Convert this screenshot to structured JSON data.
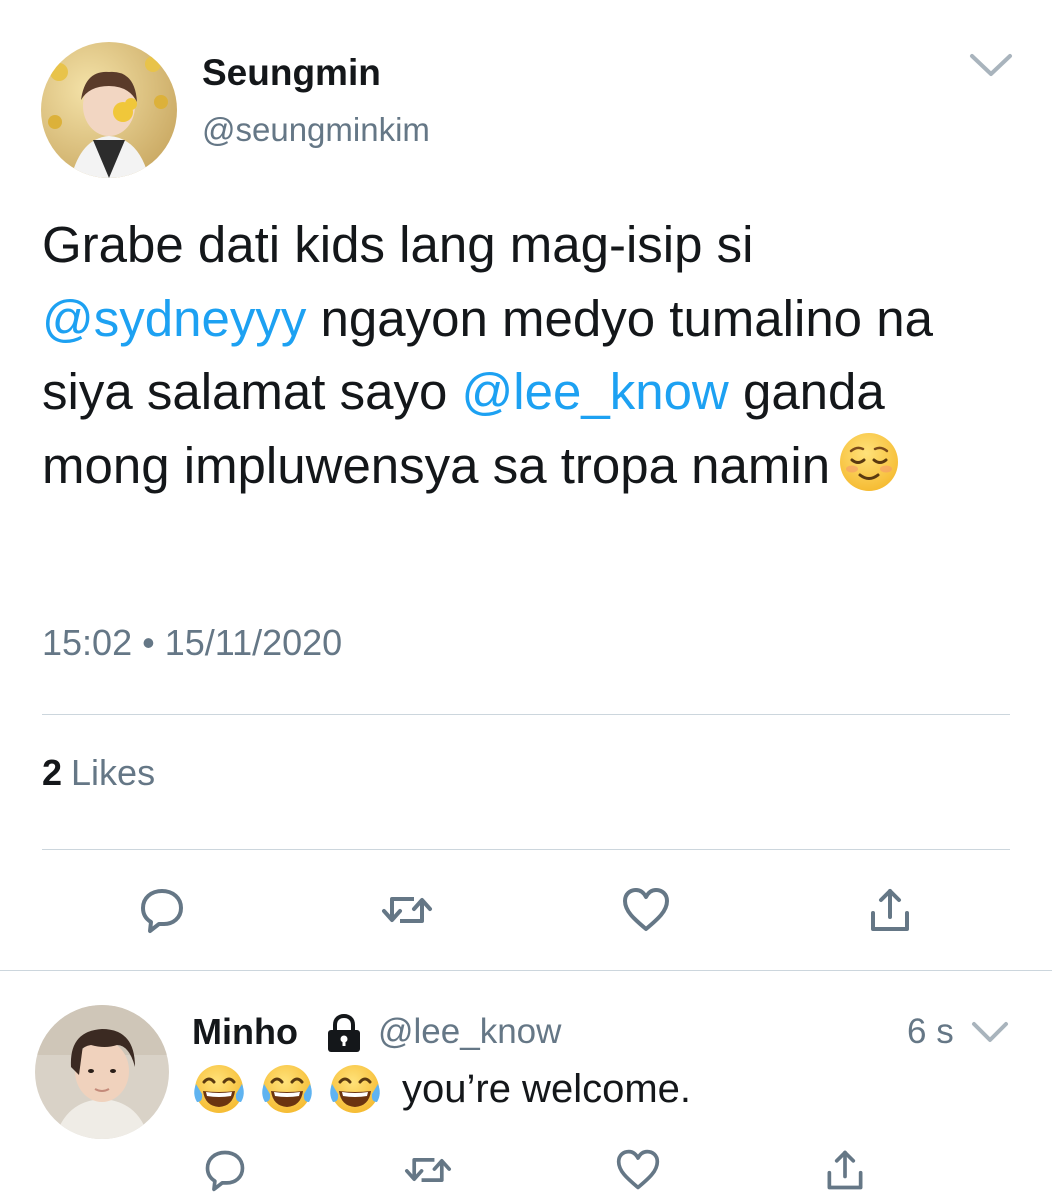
{
  "tweet": {
    "display_name": "Seungmin",
    "handle": "@seungminkim",
    "text_parts": [
      {
        "type": "text",
        "value": "Grabe dati kids lang mag-isip si "
      },
      {
        "type": "mention",
        "value": "@sydneyyy"
      },
      {
        "type": "text",
        "value": " ngayon medyo tumalino na siya salamat sayo "
      },
      {
        "type": "mention",
        "value": "@lee_know"
      },
      {
        "type": "text",
        "value": " ganda mong impluwensya sa tropa namin"
      }
    ],
    "emoji": "relieved-face",
    "timestamp": "15:02 • 15/11/2020",
    "likes_count": "2",
    "likes_label": "Likes",
    "actions": [
      "reply-icon",
      "retweet-icon",
      "like-icon",
      "share-icon"
    ]
  },
  "reply": {
    "display_name": "Minho",
    "protected_icon": "lock-icon",
    "handle": "@lee_know",
    "time": "6 s",
    "emojis": [
      "face-with-tears-of-joy",
      "face-with-tears-of-joy",
      "face-with-tears-of-joy"
    ],
    "text": "you’re welcome.",
    "actions": [
      "reply-icon",
      "retweet-icon",
      "like-icon",
      "share-icon"
    ]
  },
  "colors": {
    "text": "#14171a",
    "secondary": "#657786",
    "link": "#1da1f2",
    "divider": "#ccd6dd",
    "icon": "#657786"
  }
}
